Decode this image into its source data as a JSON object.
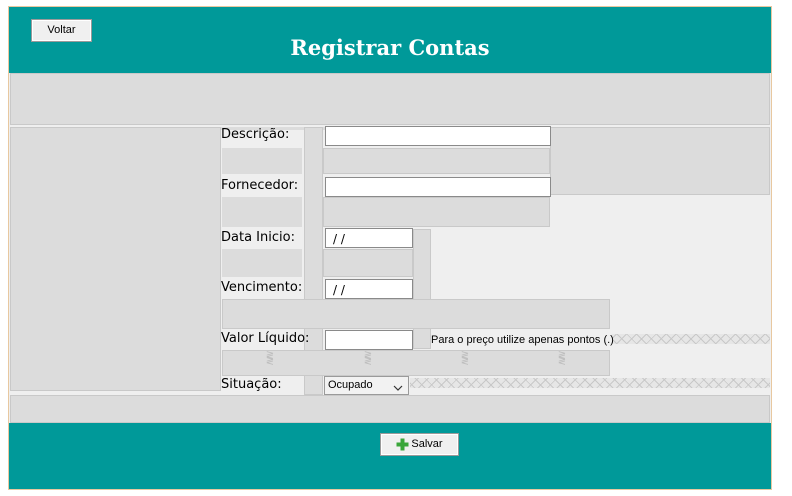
{
  "header": {
    "back_label": "Voltar",
    "title": "Registrar Contas"
  },
  "form": {
    "descricao_label": "Descrição:",
    "descricao_value": "",
    "fornecedor_label": "Fornecedor:",
    "fornecedor_value": "",
    "data_inicio_label": "Data Inicio:",
    "data_inicio_value": "/ /",
    "vencimento_label": "Vencimento:",
    "vencimento_value": "/ /",
    "valor_label": "Valor Líquido:",
    "valor_value": "",
    "valor_hint": "Para o preço utilize apenas pontos (.)",
    "situacao_label": "Situação:",
    "situacao_value": "Ocupado"
  },
  "footer": {
    "save_label": "Salvar",
    "save_icon": "plus-icon"
  },
  "colors": {
    "header": "#009999",
    "panel": "#dcdcdc",
    "save_icon": "#3aa63a"
  }
}
